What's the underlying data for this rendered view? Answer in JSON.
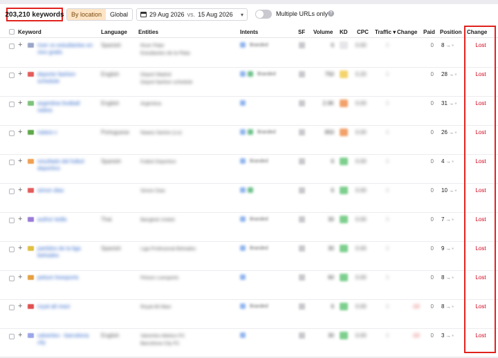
{
  "toolbar": {
    "keyword_count": "203,210 keywords",
    "by_location": "By location",
    "global": "Global",
    "date_from": "29 Aug 2026",
    "vs": "vs.",
    "date_to": "15 Aug 2026",
    "multiple_urls": "Multiple URLs only"
  },
  "columns": {
    "keyword": "Keyword",
    "language": "Language",
    "entities": "Entities",
    "intents": "Intents",
    "sf": "SF",
    "volume": "Volume",
    "kd": "KD",
    "cpc": "CPC",
    "traffic": "Traffic ▾",
    "change": "Change",
    "paid": "Paid",
    "position": "Position",
    "change_col": "Change"
  },
  "rows": [
    {
      "keyword": "river vs estudiantes en vivo gratis",
      "language": "Spanish",
      "entity1": "River Plate",
      "entity2": "Estudiantes de la Plata",
      "intent": "Branded",
      "volume": "6",
      "kd_color": "#e6e6ea",
      "cpc": "0.00",
      "traffic": "0",
      "change": "",
      "paid": "0",
      "position": "8",
      "status": "Lost",
      "flag_color": "#9aa6c8"
    },
    {
      "keyword": "deporte fashion schedule",
      "language": "English",
      "entity1": "Deport Madrid",
      "entity2": "Deport fashion schedule",
      "intent": "Branded",
      "volume": "750",
      "kd_color": "#f4d36a",
      "cpc": "0.20",
      "traffic": "0",
      "change": "",
      "paid": "0",
      "position": "28",
      "status": "Lost",
      "flag_color": "#e45b5b"
    },
    {
      "keyword": "argentina football radios",
      "language": "English",
      "entity1": "Argentina",
      "entity2": "",
      "intent": "",
      "volume": "2.0K",
      "kd_color": "#f1a169",
      "cpc": "0.00",
      "traffic": "0",
      "change": "",
      "paid": "0",
      "position": "31",
      "status": "Lost",
      "flag_color": "#7fc27a"
    },
    {
      "keyword": "naiara v",
      "language": "Portuguese",
      "entity1": "Naiara Santos (Liv)",
      "entity2": "",
      "intent": "Branded",
      "volume": "850",
      "kd_color": "#f1a169",
      "cpc": "0.00",
      "traffic": "0",
      "change": "",
      "paid": "0",
      "position": "26",
      "status": "Lost",
      "flag_color": "#5fa84a"
    },
    {
      "keyword": "resultado del futbol deportivo",
      "language": "Spanish",
      "entity1": "Futbol Deportivo",
      "entity2": "",
      "intent": "Branded",
      "volume": "6",
      "kd_color": "#7ccf8d",
      "cpc": "0.00",
      "traffic": "0",
      "change": "",
      "paid": "0",
      "position": "4",
      "status": "Lost",
      "flag_color": "#f0a050"
    },
    {
      "keyword": "simon dias",
      "language": "",
      "entity1": "Simon Dias",
      "entity2": "",
      "intent": "",
      "volume": "6",
      "kd_color": "#7ccf8d",
      "cpc": "0.00",
      "traffic": "0",
      "change": "",
      "paid": "0",
      "position": "10",
      "status": "Lost",
      "flag_color": "#e45b5b"
    },
    {
      "keyword": "author tedla",
      "language": "Thai",
      "entity1": "Bangkok United",
      "entity2": "",
      "intent": "Branded",
      "volume": "30",
      "kd_color": "#7ccf8d",
      "cpc": "0.00",
      "traffic": "0",
      "change": "",
      "paid": "0",
      "position": "7",
      "status": "Lost",
      "flag_color": "#9a7ad8"
    },
    {
      "keyword": "partidos de la liga betrades",
      "language": "Spanish",
      "entity1": "Liga Profesional Betrades",
      "entity2": "",
      "intent": "Branded",
      "volume": "30",
      "kd_color": "#7ccf8d",
      "cpc": "0.00",
      "traffic": "0",
      "change": "",
      "paid": "0",
      "position": "9",
      "status": "Lost",
      "flag_color": "#e0c040"
    },
    {
      "keyword": "pelson livesports",
      "language": "",
      "entity1": "Pelson Livesports",
      "entity2": "",
      "intent": "",
      "volume": "60",
      "kd_color": "#7ccf8d",
      "cpc": "0.00",
      "traffic": "0",
      "change": "",
      "paid": "0",
      "position": "8",
      "status": "Lost",
      "flag_color": "#e4a040"
    },
    {
      "keyword": "royal alt mavi",
      "language": "",
      "entity1": "Royal Alt Mavi",
      "entity2": "",
      "intent": "Branded",
      "volume": "6",
      "kd_color": "#7ccf8d",
      "cpc": "0.00",
      "traffic": "0",
      "change": "-10",
      "paid": "0",
      "position": "8",
      "status": "Lost",
      "flag_color": "#e05050"
    },
    {
      "keyword": "valverleo - barcelona city",
      "language": "English",
      "entity1": "Valverleo Atletico FC",
      "entity2": "Barcelona City FC",
      "intent": "",
      "volume": "30",
      "kd_color": "#7ccf8d",
      "cpc": "0.00",
      "traffic": "0",
      "change": "-10",
      "paid": "0",
      "position": "3",
      "status": "Lost",
      "flag_color": "#9aa6e8"
    }
  ]
}
